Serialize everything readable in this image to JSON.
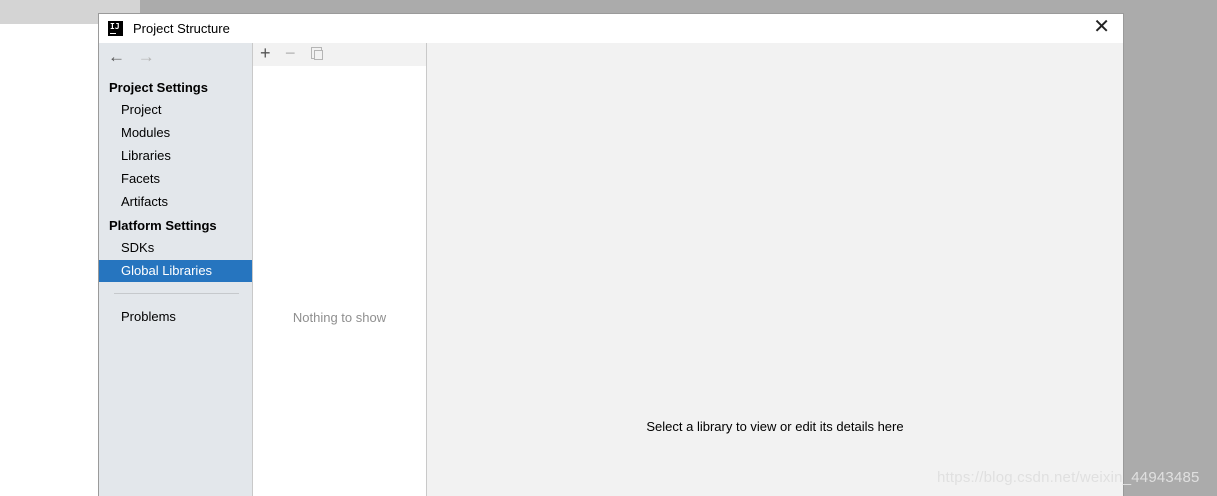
{
  "window": {
    "title": "Project Structure",
    "app_icon_text": "IJ",
    "close_symbol": "✕"
  },
  "nav": {
    "back": "←",
    "forward": "→"
  },
  "sidebar": {
    "project_settings_header": "Project Settings",
    "project_items": [
      {
        "label": "Project"
      },
      {
        "label": "Modules"
      },
      {
        "label": "Libraries"
      },
      {
        "label": "Facets"
      },
      {
        "label": "Artifacts"
      }
    ],
    "platform_settings_header": "Platform Settings",
    "platform_items": [
      {
        "label": "SDKs"
      },
      {
        "label": "Global Libraries",
        "selected": true
      }
    ],
    "problems": "Problems"
  },
  "list": {
    "toolbar": {
      "add": "+",
      "remove": "−",
      "copy_icon": "copy-icon"
    },
    "empty_text": "Nothing to show"
  },
  "details": {
    "placeholder": "Select a library to view or edit its details here"
  },
  "watermark": "https://blog.csdn.net/weixin_44943485",
  "colors": {
    "selection": "#2675bf",
    "sidebar_bg": "#e3e7eb",
    "panel_bg": "#f2f2f2"
  }
}
